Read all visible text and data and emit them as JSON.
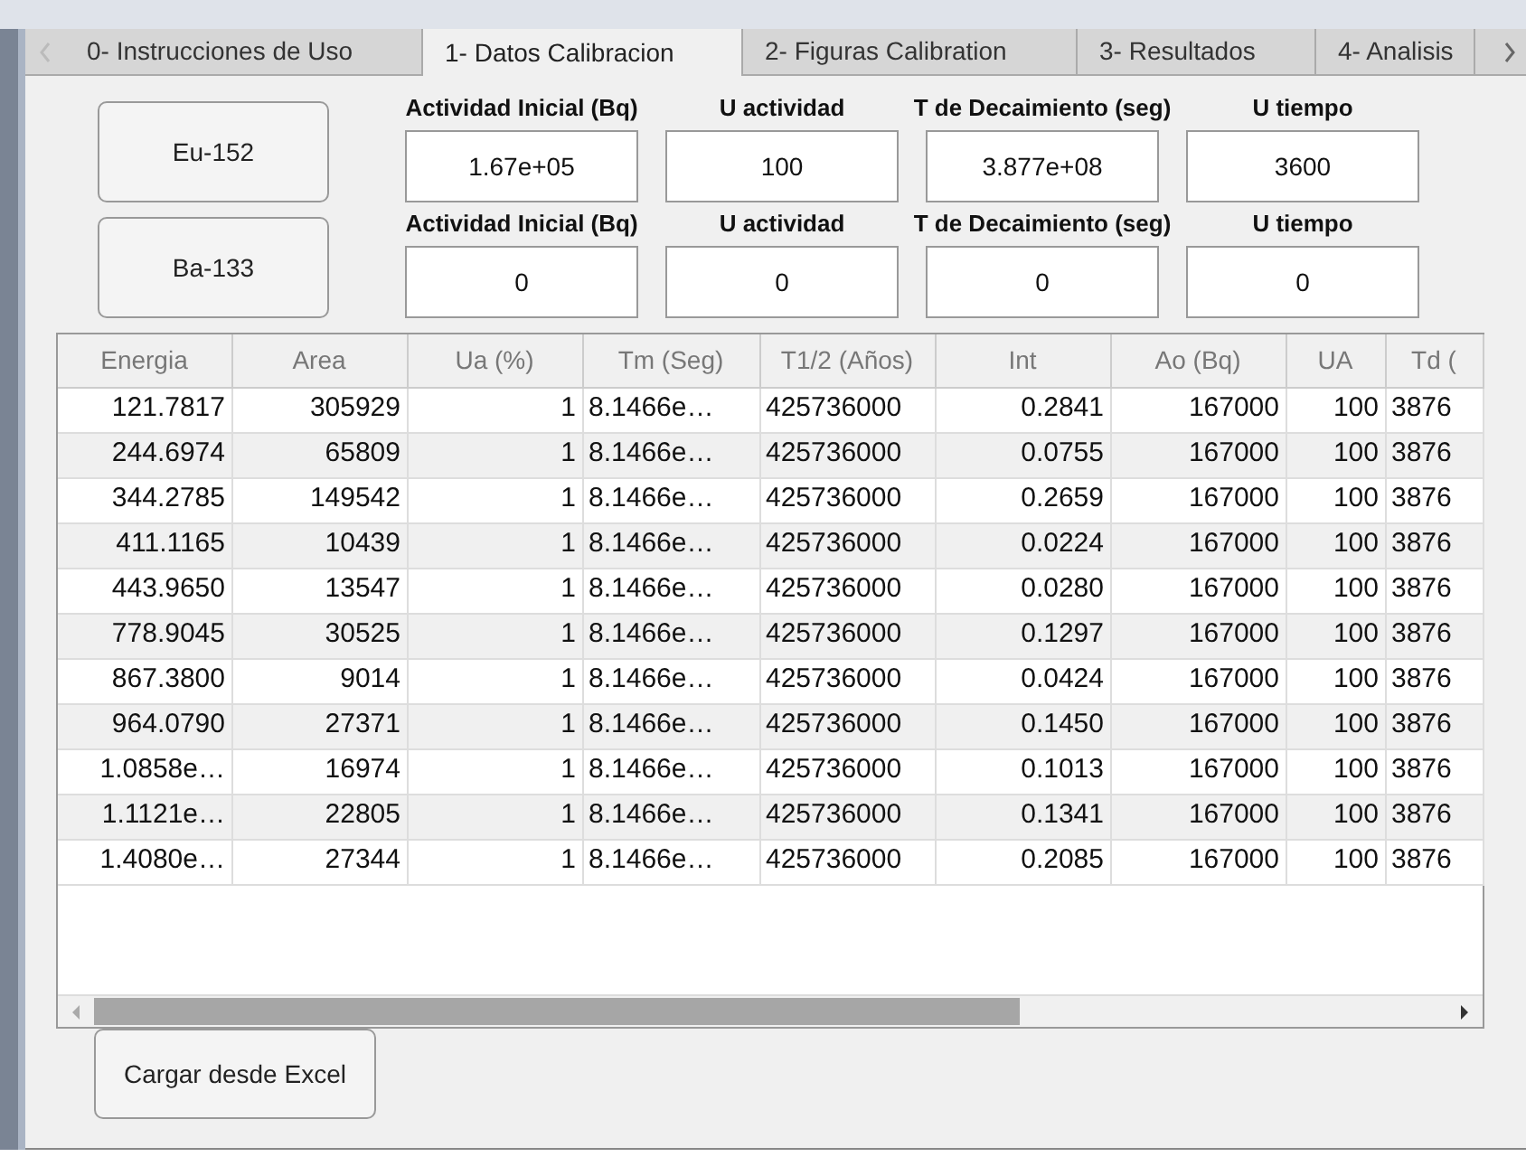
{
  "tabs": [
    {
      "label": "0- Instrucciones de Uso",
      "selected": false
    },
    {
      "label": "1- Datos Calibracion",
      "selected": true
    },
    {
      "label": "2- Figuras Calibration",
      "selected": false
    },
    {
      "label": "3- Resultados",
      "selected": false
    },
    {
      "label": "4- Analisis",
      "selected": false
    }
  ],
  "sources": [
    {
      "button": "Eu-152",
      "fields": [
        {
          "label": "Actividad Inicial (Bq)",
          "value": "1.67e+05"
        },
        {
          "label": "U actividad",
          "value": "100"
        },
        {
          "label": "T de Decaimiento (seg)",
          "value": "3.877e+08"
        },
        {
          "label": "U tiempo",
          "value": "3600"
        }
      ]
    },
    {
      "button": "Ba-133",
      "fields": [
        {
          "label": "Actividad Inicial (Bq)",
          "value": "0"
        },
        {
          "label": "U actividad",
          "value": "0"
        },
        {
          "label": "T de Decaimiento (seg)",
          "value": "0"
        },
        {
          "label": "U tiempo",
          "value": "0"
        }
      ]
    }
  ],
  "table": {
    "columns": [
      "Energia",
      "Area",
      "Ua (%)",
      "Tm (Seg)",
      "T1/2 (Años)",
      "Int",
      "Ao (Bq)",
      "UA",
      "Td ("
    ],
    "rows": [
      [
        "121.7817",
        "305929",
        "1",
        "8.1466e…",
        "425736000",
        "0.2841",
        "167000",
        "100",
        "3876"
      ],
      [
        "244.6974",
        "65809",
        "1",
        "8.1466e…",
        "425736000",
        "0.0755",
        "167000",
        "100",
        "3876"
      ],
      [
        "344.2785",
        "149542",
        "1",
        "8.1466e…",
        "425736000",
        "0.2659",
        "167000",
        "100",
        "3876"
      ],
      [
        "411.1165",
        "10439",
        "1",
        "8.1466e…",
        "425736000",
        "0.0224",
        "167000",
        "100",
        "3876"
      ],
      [
        "443.9650",
        "13547",
        "1",
        "8.1466e…",
        "425736000",
        "0.0280",
        "167000",
        "100",
        "3876"
      ],
      [
        "778.9045",
        "30525",
        "1",
        "8.1466e…",
        "425736000",
        "0.1297",
        "167000",
        "100",
        "3876"
      ],
      [
        "867.3800",
        "9014",
        "1",
        "8.1466e…",
        "425736000",
        "0.0424",
        "167000",
        "100",
        "3876"
      ],
      [
        "964.0790",
        "27371",
        "1",
        "8.1466e…",
        "425736000",
        "0.1450",
        "167000",
        "100",
        "3876"
      ],
      [
        "1.0858e…",
        "16974",
        "1",
        "8.1466e…",
        "425736000",
        "0.1013",
        "167000",
        "100",
        "3876"
      ],
      [
        "1.1121e…",
        "22805",
        "1",
        "8.1466e…",
        "425736000",
        "0.1341",
        "167000",
        "100",
        "3876"
      ],
      [
        "1.4080e…",
        "27344",
        "1",
        "8.1466e…",
        "425736000",
        "0.2085",
        "167000",
        "100",
        "3876"
      ]
    ]
  },
  "load_button": "Cargar desde Excel"
}
